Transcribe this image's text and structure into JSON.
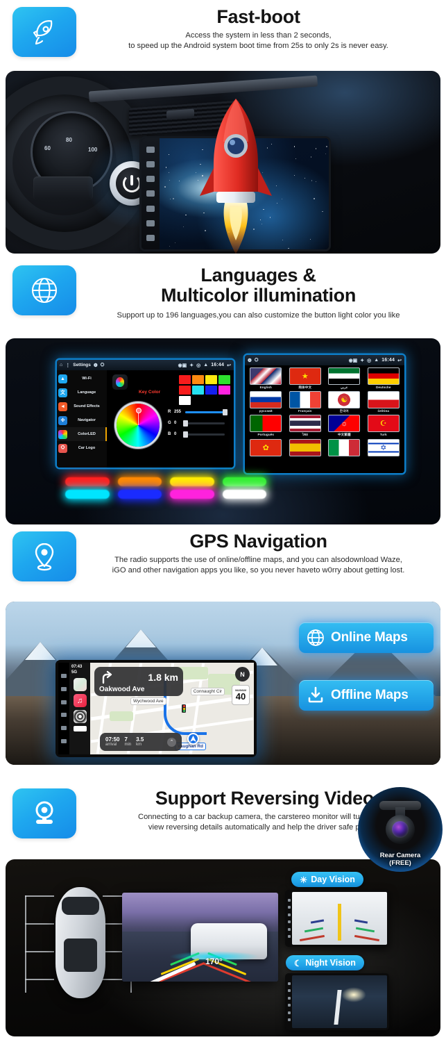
{
  "sections": [
    {
      "id": "fast-boot",
      "icon": "rocket-icon",
      "title": "Fast-boot",
      "subtitle_lines": [
        "Access the system in less than 2 seconds,",
        "to speed up the Android system boot time from 25s to only 2s is never easy."
      ]
    },
    {
      "id": "languages",
      "icon": "globe-icon",
      "title_lines": [
        "Languages &",
        "Multicolor illumination"
      ],
      "subtitle_lines": [
        "Support up to 196 languages,you can also customize the button light color you like"
      ]
    },
    {
      "id": "gps",
      "icon": "map-pin-icon",
      "title": "GPS Navigation",
      "subtitle_lines": [
        "The radio supports the use of online/offline maps, and you can alsodownload Waze,",
        "iGO and other navigation apps you like, so you never haveto w0rry about getting lost."
      ]
    },
    {
      "id": "reversing",
      "icon": "camera-icon",
      "title": "Support Reversing Video",
      "subtitle_lines": [
        "Connecting to a car backup camera, the carstereo monitor will turn to rear",
        "view reversing details automatically and help the driver safe parking"
      ]
    }
  ],
  "dashboard": {
    "gauge_ticks": [
      "60",
      "80",
      "100"
    ],
    "power_button": "power-icon"
  },
  "settings_screen": {
    "statusbar": {
      "title": "Settings",
      "time": "16:44",
      "icons": [
        "home-icon",
        "menu-icon",
        "apps-icon",
        "bluetooth-icon",
        "location-icon",
        "wifi-icon",
        "back-icon"
      ]
    },
    "nav_items": [
      {
        "label": "Wi-Fi",
        "icon": "wifi-icon",
        "color": "#1ea7ef",
        "active": false
      },
      {
        "label": "Language",
        "icon": "language-icon",
        "color": "#1ea7ef",
        "active": false
      },
      {
        "label": "Sound Effects",
        "icon": "speaker-icon",
        "color": "#f05a28",
        "active": false
      },
      {
        "label": "Navigator",
        "icon": "navigator-icon",
        "color": "#1e7fd8",
        "active": false
      },
      {
        "label": "ColorLED",
        "icon": "colorled-icon",
        "color": "#22c0ff",
        "active": true
      },
      {
        "label": "Car Logo",
        "icon": "car-logo-icon",
        "color": "#e8554e",
        "active": false
      }
    ],
    "key_color_label": "Key Color",
    "swatches": [
      "#f81c1c",
      "#ff8a10",
      "#ffe90f",
      "#2ee02e",
      "#f81c1c",
      "#24e0f0",
      "#1520f0",
      "#ff22e0",
      "#ffffff"
    ],
    "sliders": [
      {
        "key": "R",
        "value": "255",
        "pct": 100,
        "color": "#1e90ff"
      },
      {
        "key": "G",
        "value": "0",
        "pct": 0,
        "color": "#1e90ff"
      },
      {
        "key": "B",
        "value": "0",
        "pct": 0,
        "color": "#1e90ff"
      }
    ]
  },
  "language_screen": {
    "statusbar_time": "16:44",
    "languages": [
      {
        "name": "English",
        "flag": "uk-us-flag"
      },
      {
        "name": "简体中文",
        "flag": "china-flag"
      },
      {
        "name": "عربي",
        "flag": "uae-flag"
      },
      {
        "name": "Deutsche",
        "flag": "germany-flag"
      },
      {
        "name": "русский",
        "flag": "russia-flag"
      },
      {
        "name": "Français",
        "flag": "france-flag"
      },
      {
        "name": "한국어",
        "flag": "korea-flag"
      },
      {
        "name": "čeština",
        "flag": "czech-flag"
      },
      {
        "name": "Português",
        "flag": "portugal-flag"
      },
      {
        "name": "ไทย",
        "flag": "thailand-flag"
      },
      {
        "name": "中文繁體",
        "flag": "taiwan-flag"
      },
      {
        "name": "Turk",
        "flag": "turkey-flag"
      },
      {
        "name": "",
        "flag": "hongkong-flag"
      },
      {
        "name": "",
        "flag": "spain-flag"
      },
      {
        "name": "",
        "flag": "italy-flag"
      },
      {
        "name": "",
        "flag": "israel-flag"
      }
    ]
  },
  "led_strip": {
    "row1": [
      "#ff1f1f",
      "#ff8a00",
      "#ffee00",
      "#33ee33"
    ],
    "row2": [
      "#00e5ff",
      "#1a2bff",
      "#ff22dd",
      "#ffffff"
    ]
  },
  "gps_screen": {
    "status_time": "07:43",
    "status_network": "5G",
    "nav_card": {
      "distance": "1.8 km",
      "street": "Oakwood Ave",
      "maneuver": "turn-right-icon"
    },
    "eta": [
      {
        "value": "07:50",
        "label": "arrival"
      },
      {
        "value": "7",
        "label": "min"
      },
      {
        "value": "3.5",
        "label": "km"
      }
    ],
    "compass": "N",
    "speed_limit": {
      "caption": "MAXIMUM",
      "value": "40"
    },
    "street_labels": [
      "Connaught Cir",
      "Wychwood Ave",
      "Vaughan Rd"
    ],
    "dock_apps": [
      "maps-app-icon",
      "music-app-icon",
      "settings-app-icon",
      "battery-icon"
    ]
  },
  "map_buttons": [
    {
      "label": "Online Maps",
      "icon": "globe-icon"
    },
    {
      "label": "Offline Maps",
      "icon": "download-icon"
    }
  ],
  "reversing": {
    "angle_label": "170°",
    "rear_camera_badge": {
      "line1": "Rear Camera",
      "line2": "(FREE)"
    },
    "vision_badges": [
      {
        "label": "Day Vision",
        "icon": "sun-icon"
      },
      {
        "label": "Night Vision",
        "icon": "moon-icon"
      }
    ]
  },
  "colors": {
    "accent_blue": "#1e9be8",
    "accent_blue_light": "#36c1f4",
    "title_black": "#141414",
    "route_blue": "#1a73e8"
  }
}
